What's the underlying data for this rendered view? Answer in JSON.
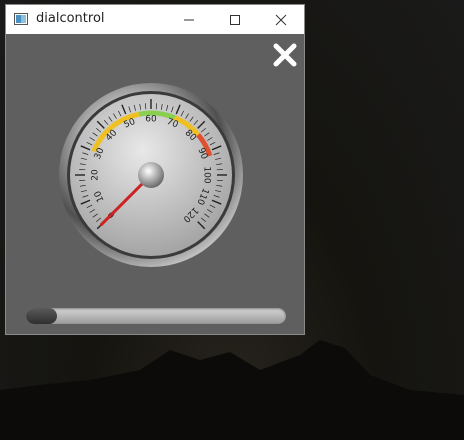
{
  "window": {
    "title": "dialcontrol",
    "minimize_icon": "minimize-icon",
    "maximize_icon": "maximize-icon",
    "close_icon": "close-icon"
  },
  "content": {
    "close_button_icon": "close-x-icon"
  },
  "dial": {
    "tick_labels": [
      "0",
      "10",
      "20",
      "30",
      "40",
      "50",
      "60",
      "70",
      "80",
      "90",
      "100",
      "110",
      "120"
    ],
    "min": 0,
    "max": 120,
    "value": 0,
    "zones": [
      {
        "from": 30,
        "to": 55,
        "color": "#f0c020"
      },
      {
        "from": 55,
        "to": 70,
        "color": "#8ad050"
      },
      {
        "from": 70,
        "to": 82,
        "color": "#f0c020"
      },
      {
        "from": 82,
        "to": 92,
        "color": "#e05030"
      }
    ],
    "needle_color": "#cc2222"
  },
  "progress": {
    "fraction": 0.12
  }
}
